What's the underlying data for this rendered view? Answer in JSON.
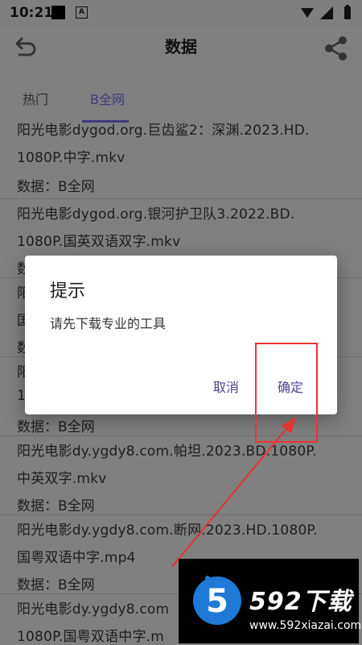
{
  "status_bar": {
    "time": "10:21",
    "badge": "A"
  },
  "app_bar": {
    "title": "数据"
  },
  "tabs": [
    {
      "label": "热门",
      "selected": false
    },
    {
      "label": "B全网",
      "selected": true
    }
  ],
  "list": {
    "items": [
      {
        "line1": "阳光电影dygod.org.巨齿鲨2：深渊.2023.HD.",
        "line2": "1080P.中字.mkv",
        "meta": "数据：B全网"
      },
      {
        "line1": "阳光电影dygod.org.银河护卫队3.2022.BD.",
        "line2": "1080P.国英双语双字.mkv",
        "meta": "数"
      },
      {
        "line1": "阳",
        "line2": "国",
        "meta": "数"
      },
      {
        "line1": "阳",
        "line2": "1",
        "meta": "数据：B全网"
      },
      {
        "line1": "阳光电影dy.ygdy8.com.帕坦.2023.BD.1080P.",
        "line2": "中英双字.mkv",
        "meta": "数据：B全网"
      },
      {
        "line1": "阳光电影dy.ygdy8.com.断网.2023.HD.1080P.",
        "line2": "国粤双语中字.mp4",
        "meta": "数据：B全网"
      },
      {
        "line1": "阳光电影dy.ygdy8.com",
        "line2": "1080P.国粤双语中字.m",
        "meta": ""
      }
    ]
  },
  "dialog": {
    "title": "提示",
    "message": "请先下载专业的工具",
    "cancel_label": "取消",
    "ok_label": "确定"
  },
  "watermark": {
    "brand": "592下载",
    "url": "www.592xiazai.com",
    "digit": "5"
  },
  "colors": {
    "accent": "#4b4690",
    "annotation": "#e33333"
  }
}
